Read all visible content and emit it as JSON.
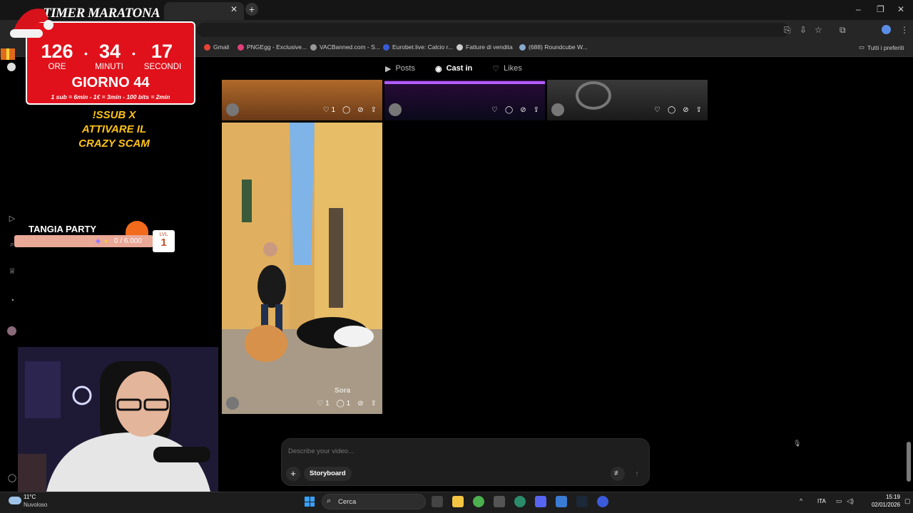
{
  "browser": {
    "bookmarks": [
      {
        "label": "Gmail",
        "color": "#ea4335"
      },
      {
        "label": "PNGEgg - Exclusive...",
        "color": "#e0407a"
      },
      {
        "label": "VACBanned.com - S...",
        "color": "#999999"
      },
      {
        "label": "Eurobet.live: Calcio r...",
        "color": "#3a5bd9"
      },
      {
        "label": "Fatture di vendita",
        "color": "#cccccc"
      },
      {
        "label": "(688) Roundcube W...",
        "color": "#88aacc"
      }
    ],
    "all_bookmarks": "Tutti i preferiti"
  },
  "overlay": {
    "timer_title": "TIMER MARATONA",
    "hours": "126",
    "minutes": "34",
    "seconds": "17",
    "hours_label": "ORE",
    "minutes_label": "MINUTI",
    "seconds_label": "SECONDI",
    "day": "GIORNO 44",
    "rates": "1 sub = 6min - 1€ = 3min - 100 bits = 2min",
    "promo": [
      "!SSUB X",
      "ATTIVARE IL",
      "CRAZY SCAM"
    ],
    "tangia_title": "TANGIA PARTY",
    "tangia_value": "0 / 6.000",
    "lvl_label": "LVL",
    "lvl_value": "1"
  },
  "sora": {
    "tabs": [
      {
        "label": "Posts",
        "icon": "play-square-icon"
      },
      {
        "label": "Cast in",
        "icon": "user-circle-icon"
      },
      {
        "label": "Likes",
        "icon": "heart-icon"
      }
    ],
    "tiles": [
      {
        "likes": "1",
        "comments": ""
      },
      {
        "likes": "",
        "comments": ""
      },
      {
        "likes": "",
        "comments": ""
      },
      {
        "likes": "1",
        "comments": "1",
        "watermark": "Sora"
      }
    ],
    "prompt_placeholder": "Describe your video...",
    "storyboard_label": "Storyboard"
  },
  "taskbar": {
    "temperature": "11°C",
    "weather": "Nuvoloso",
    "search_label": "Cerca",
    "language": "ITA",
    "time": "15:19",
    "date": "02/01/2026"
  }
}
